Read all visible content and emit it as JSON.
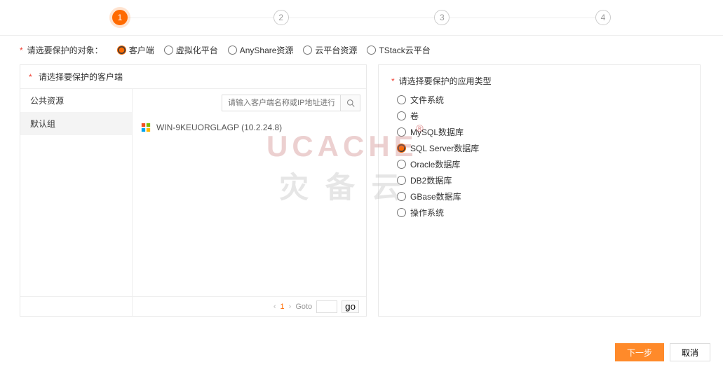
{
  "steps": {
    "labels": [
      "1",
      "2",
      "3",
      "4"
    ],
    "active": 1
  },
  "target": {
    "label": "请选要保护的对象：",
    "options": [
      "客户端",
      "虚拟化平台",
      "AnyShare资源",
      "云平台资源",
      "TStack云平台"
    ],
    "selected": "客户端"
  },
  "clientPanel": {
    "title": "请选择要保护的客户端",
    "searchPlaceholder": "请输入客户端名称或IP地址进行查找",
    "sidebar": [
      "公共资源",
      "默认组"
    ],
    "sidebarActive": "默认组",
    "clients": [
      {
        "name": "WIN-9KEUORGLAGP",
        "ip": "10.2.24.8"
      }
    ],
    "pager": {
      "current": "1",
      "gotoLabel": "Goto",
      "goLabel": "go"
    }
  },
  "typePanel": {
    "title": "请选择要保护的应用类型",
    "options": [
      "文件系统",
      "卷",
      "MySQL数据库",
      "SQL Server数据库",
      "Oracle数据库",
      "DB2数据库",
      "GBase数据库",
      "操作系统"
    ],
    "selected": "SQL Server数据库"
  },
  "footer": {
    "next": "下一步",
    "cancel": "取消"
  },
  "watermark": {
    "line1": "UCACHE",
    "line2": "灾 备 云",
    "reg": "®"
  }
}
